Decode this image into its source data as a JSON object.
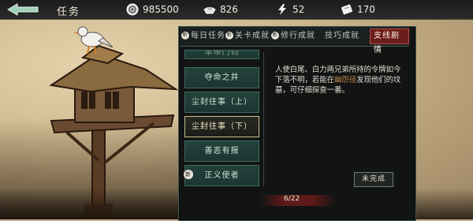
{
  "header": {
    "title": "任务",
    "resources": [
      {
        "icon": "coin-icon",
        "value": "985500"
      },
      {
        "icon": "ingot-icon",
        "value": "826"
      },
      {
        "icon": "lightning-icon",
        "value": "52"
      },
      {
        "icon": "ticket-icon",
        "value": "170"
      }
    ]
  },
  "tabs": [
    {
      "label": "每日任务",
      "new": true
    },
    {
      "label": "关卡成就",
      "new": true
    },
    {
      "label": "修行成就",
      "new": true
    },
    {
      "label": "技巧成就",
      "new": false
    },
    {
      "label": "支线剧情",
      "new": false,
      "active": true
    }
  ],
  "tab_new_mark": "新",
  "quests": [
    {
      "label": "本帝门钧",
      "state": "partial"
    },
    {
      "label": "夺命之井",
      "state": "normal"
    },
    {
      "label": "尘封往事（上）",
      "state": "normal"
    },
    {
      "label": "尘封往事（下）",
      "state": "selected"
    },
    {
      "label": "善恶有报",
      "state": "normal"
    },
    {
      "label": "正义使者",
      "state": "new"
    }
  ],
  "description": {
    "part1": "人使白尾、白力两兄弟所持的令牌如今下落不明，若能在",
    "highlight": "幽怨径",
    "part2": "发现他们的坟墓，可仔细探查一番。"
  },
  "status_button": "未完成",
  "progress": "6/22",
  "colors": {
    "accent": "#6b1d1b",
    "teal": "#3e5c55",
    "highlight": "#c78a4b"
  }
}
